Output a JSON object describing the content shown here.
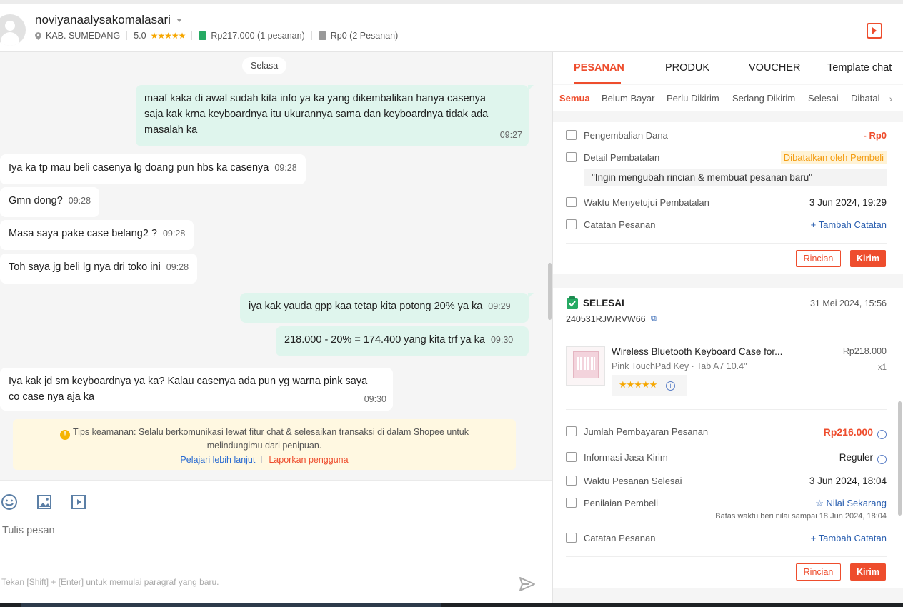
{
  "header": {
    "username": "noviyanaalysakomalasari",
    "location": "KAB. SUMEDANG",
    "rating": "5.0",
    "stars": "★★★★★",
    "paid_total": "Rp217.000",
    "paid_count": "(1 pesanan)",
    "unpaid_total": "Rp0",
    "unpaid_count": "(2 Pesanan)"
  },
  "chat": {
    "day_label": "Selasa",
    "messages": [
      {
        "dir": "out",
        "text": "maaf kaka di awal sudah kita info ya ka yang dikembalikan hanya casenya saja kak krna keyboardnya itu ukurannya sama dan keyboardnya tidak ada masalah ka",
        "time": "09:27"
      },
      {
        "dir": "in",
        "text": "Iya ka tp mau beli casenya lg doang pun hbs ka casenya",
        "time": "09:28"
      },
      {
        "dir": "in",
        "text": "Gmn dong?",
        "time": "09:28"
      },
      {
        "dir": "in",
        "text": "Masa saya pake case belang2 ?",
        "time": "09:28"
      },
      {
        "dir": "in",
        "text": "Toh saya jg beli lg nya dri toko ini",
        "time": "09:28"
      },
      {
        "dir": "out",
        "text": "iya kak yauda gpp kaa tetap kita potong 20% ya ka",
        "time": "09:29"
      },
      {
        "dir": "out",
        "text": "218.000 - 20% = 174.400 yang kita trf ya ka",
        "time": "09:30"
      },
      {
        "dir": "in",
        "text": "Iya kak jd sm keyboardnya ya ka? Kalau casenya ada pun yg warna pink saya co case nya aja ka",
        "time": "09:30"
      }
    ],
    "tips_line1": "Tips keamanan: Selalu berkomunikasi lewat fitur chat & selesaikan transaksi di dalam Shopee untuk",
    "tips_line2": "melindungimu dari penipuan.",
    "tips_link_learn": "Pelajari lebih lanjut",
    "tips_link_report": "Laporkan pengguna"
  },
  "composer": {
    "placeholder": "Tulis pesan",
    "hint": "Tekan [Shift] + [Enter] untuk memulai paragraf yang baru."
  },
  "panel": {
    "tabs": [
      "PESANAN",
      "PRODUK",
      "VOUCHER",
      "Template chat"
    ],
    "subtabs": [
      "Semua",
      "Belum Bayar",
      "Perlu Dikirim",
      "Sedang Dikirim",
      "Selesai",
      "Dibatalkan"
    ],
    "card1": {
      "refund_label": "Pengembalian Dana",
      "refund_value": "- Rp0",
      "cancel_label": "Detail Pembatalan",
      "cancel_value": "Dibatalkan oleh Pembeli",
      "cancel_reason": "\"Ingin mengubah rincian & membuat pesanan baru\"",
      "approve_label": "Waktu Menyetujui Pembatalan",
      "approve_value": "3 Jun 2024, 19:29",
      "note_label": "Catatan Pesanan",
      "note_action": "+ Tambah Catatan",
      "btn_detail": "Rincian",
      "btn_send": "Kirim"
    },
    "card2": {
      "status": "SELESAI",
      "date": "31 Mei 2024, 15:56",
      "order_id": "240531RJWRVW66",
      "product_name": "Wireless Bluetooth Keyboard Case for...",
      "product_variant": "Pink TouchPad Key · Tab A7 10.4\"",
      "product_price": "Rp218.000",
      "product_qty": "x1",
      "product_stars": "★★★★★",
      "pay_label": "Jumlah Pembayaran Pesanan",
      "pay_value": "Rp216.000",
      "ship_label": "Informasi Jasa Kirim",
      "ship_value": "Reguler",
      "done_label": "Waktu Pesanan Selesai",
      "done_value": "3 Jun 2024, 18:04",
      "review_label": "Penilaian Pembeli",
      "review_action": "☆ Nilai Sekarang",
      "review_deadline": "Batas waktu beri nilai sampai 18 Jun 2024, 18:04",
      "note_label": "Catatan Pesanan",
      "note_action": "+ Tambah Catatan",
      "btn_detail": "Rincian",
      "btn_send": "Kirim"
    }
  },
  "colors": {
    "accent": "#ee4d2d",
    "bubble_out": "#dff5ed",
    "link": "#2a5fb0"
  }
}
